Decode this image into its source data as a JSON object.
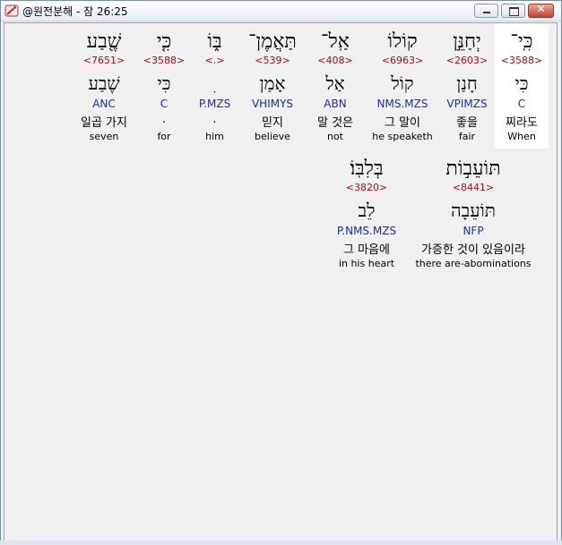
{
  "window": {
    "title": "@원전분해 - 잠 26:25"
  },
  "words": [
    {
      "hebrew": "כִּֽי־",
      "strong": "<3588>",
      "lemma": "כִּי",
      "morph": "C",
      "korean": "찌라도",
      "english": "When",
      "selected": true
    },
    {
      "hebrew": "יְחַנֵּ֣ן",
      "strong": "<2603>",
      "lemma": "חָנַן",
      "morph": "VPIMZS",
      "korean": "좋을",
      "english": "fair"
    },
    {
      "hebrew": "קוֹלוֹ",
      "strong": "<6963>",
      "lemma": "קוֹל",
      "morph": "NMS.MZS",
      "korean": "그 말이",
      "english": "he speaketh"
    },
    {
      "hebrew": "אַֽל־",
      "strong": "<408>",
      "lemma": "אַל",
      "morph": "ABN",
      "korean": "말 것은",
      "english": "not"
    },
    {
      "hebrew": "תַּאֲמֶן־",
      "strong": "<539>",
      "lemma": "אָמַן",
      "morph": "VHIMYS",
      "korean": "믿지",
      "english": "believe"
    },
    {
      "hebrew": "בּ֑וֹ",
      "strong": "<.>",
      "lemma": "ִ",
      "morph": "P.MZS",
      "korean": ".",
      "english": "him"
    },
    {
      "hebrew": "כִּ֤י",
      "strong": "<3588>",
      "lemma": "כִּי",
      "morph": "C",
      "korean": ".",
      "english": "for"
    },
    {
      "hebrew": "שֶׁ֖בַע",
      "strong": "<7651>",
      "lemma": "שֶׁבַע",
      "morph": "ANC",
      "korean": "일곱 가지",
      "english": "seven"
    },
    {
      "hebrew": "תּוֹעֵב֣וֹת",
      "strong": "<8441>",
      "lemma": "תּוֹעֵבָה",
      "morph": "NFP",
      "korean": "가증한 것이 있음이라",
      "english": "there are-abominations"
    },
    {
      "hebrew": "בְּלִבּֽוֹ׃",
      "strong": "<3820>",
      "lemma": "לֵב",
      "morph": "P.NMS.MZS",
      "korean": "그 마음에",
      "english": "in his heart"
    }
  ]
}
